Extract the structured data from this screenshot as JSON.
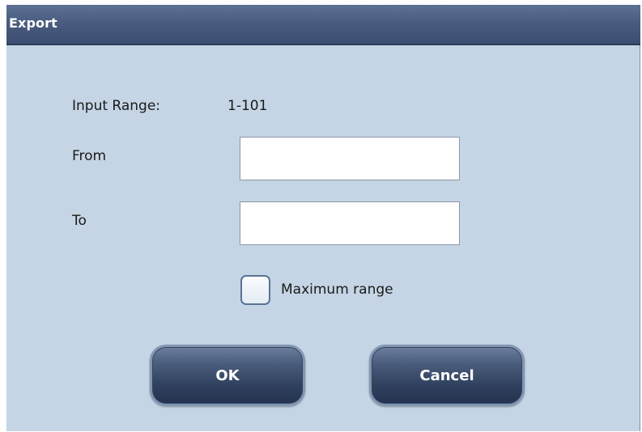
{
  "dialog": {
    "title": "Export",
    "input_range_label": "Input Range:",
    "input_range_value": "1-101",
    "from_label": "From",
    "from_value": "",
    "to_label": "To",
    "to_value": "",
    "maximum_range_label": "Maximum range",
    "maximum_range_checked": false,
    "ok_label": "OK",
    "cancel_label": "Cancel"
  },
  "colors": {
    "title_bar": "#495c7f",
    "dialog_background": "#c5d5e5",
    "button_background": "#34445f",
    "checkbox_border": "#5a7394"
  }
}
